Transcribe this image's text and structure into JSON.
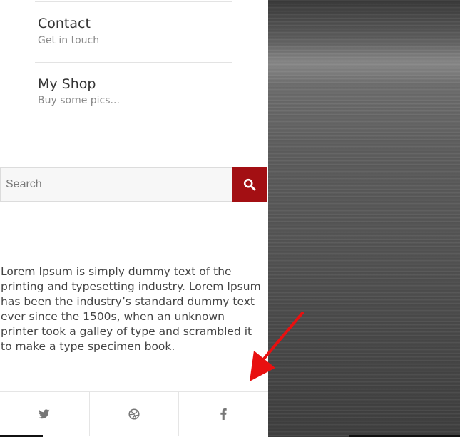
{
  "menu": {
    "items": [
      {
        "title": "Contact",
        "subtitle": "Get in touch"
      },
      {
        "title": "My Shop",
        "subtitle": "Buy some pics..."
      }
    ]
  },
  "search": {
    "placeholder": "Search"
  },
  "about": {
    "text": "Lorem Ipsum is simply dummy text of the printing and typesetting industry. Lorem Ipsum has been the industry’s standard dummy text ever since the 1500s, when an unknown printer took a galley of type and scrambled it to make a type specimen book."
  },
  "social": {
    "icons": [
      "twitter-icon",
      "dribbble-icon",
      "facebook-icon"
    ]
  },
  "colors": {
    "accent": "#a30f13",
    "annotation": "#e81010"
  }
}
